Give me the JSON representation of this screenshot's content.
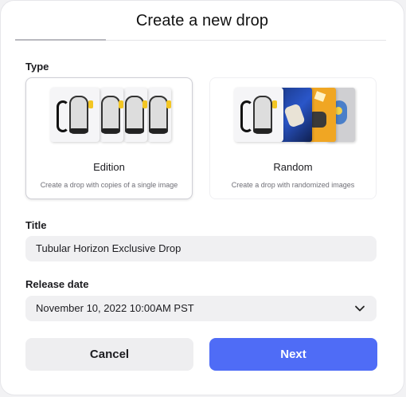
{
  "dialog": {
    "title": "Create a new drop"
  },
  "type_section": {
    "label": "Type",
    "options": [
      {
        "title": "Edition",
        "description": "Create a drop with copies of a single image",
        "selected": true
      },
      {
        "title": "Random",
        "description": "Create a drop with randomized images",
        "selected": false
      }
    ]
  },
  "title_field": {
    "label": "Title",
    "value": "Tubular Horizon Exclusive Drop"
  },
  "release_date": {
    "label": "Release date",
    "value": "November 10, 2022 10:00AM PST"
  },
  "actions": {
    "cancel_label": "Cancel",
    "next_label": "Next"
  },
  "colors": {
    "accent": "#4f6cf6",
    "cancel_bg": "#eeeef0",
    "field_bg": "#f0f0f2"
  }
}
